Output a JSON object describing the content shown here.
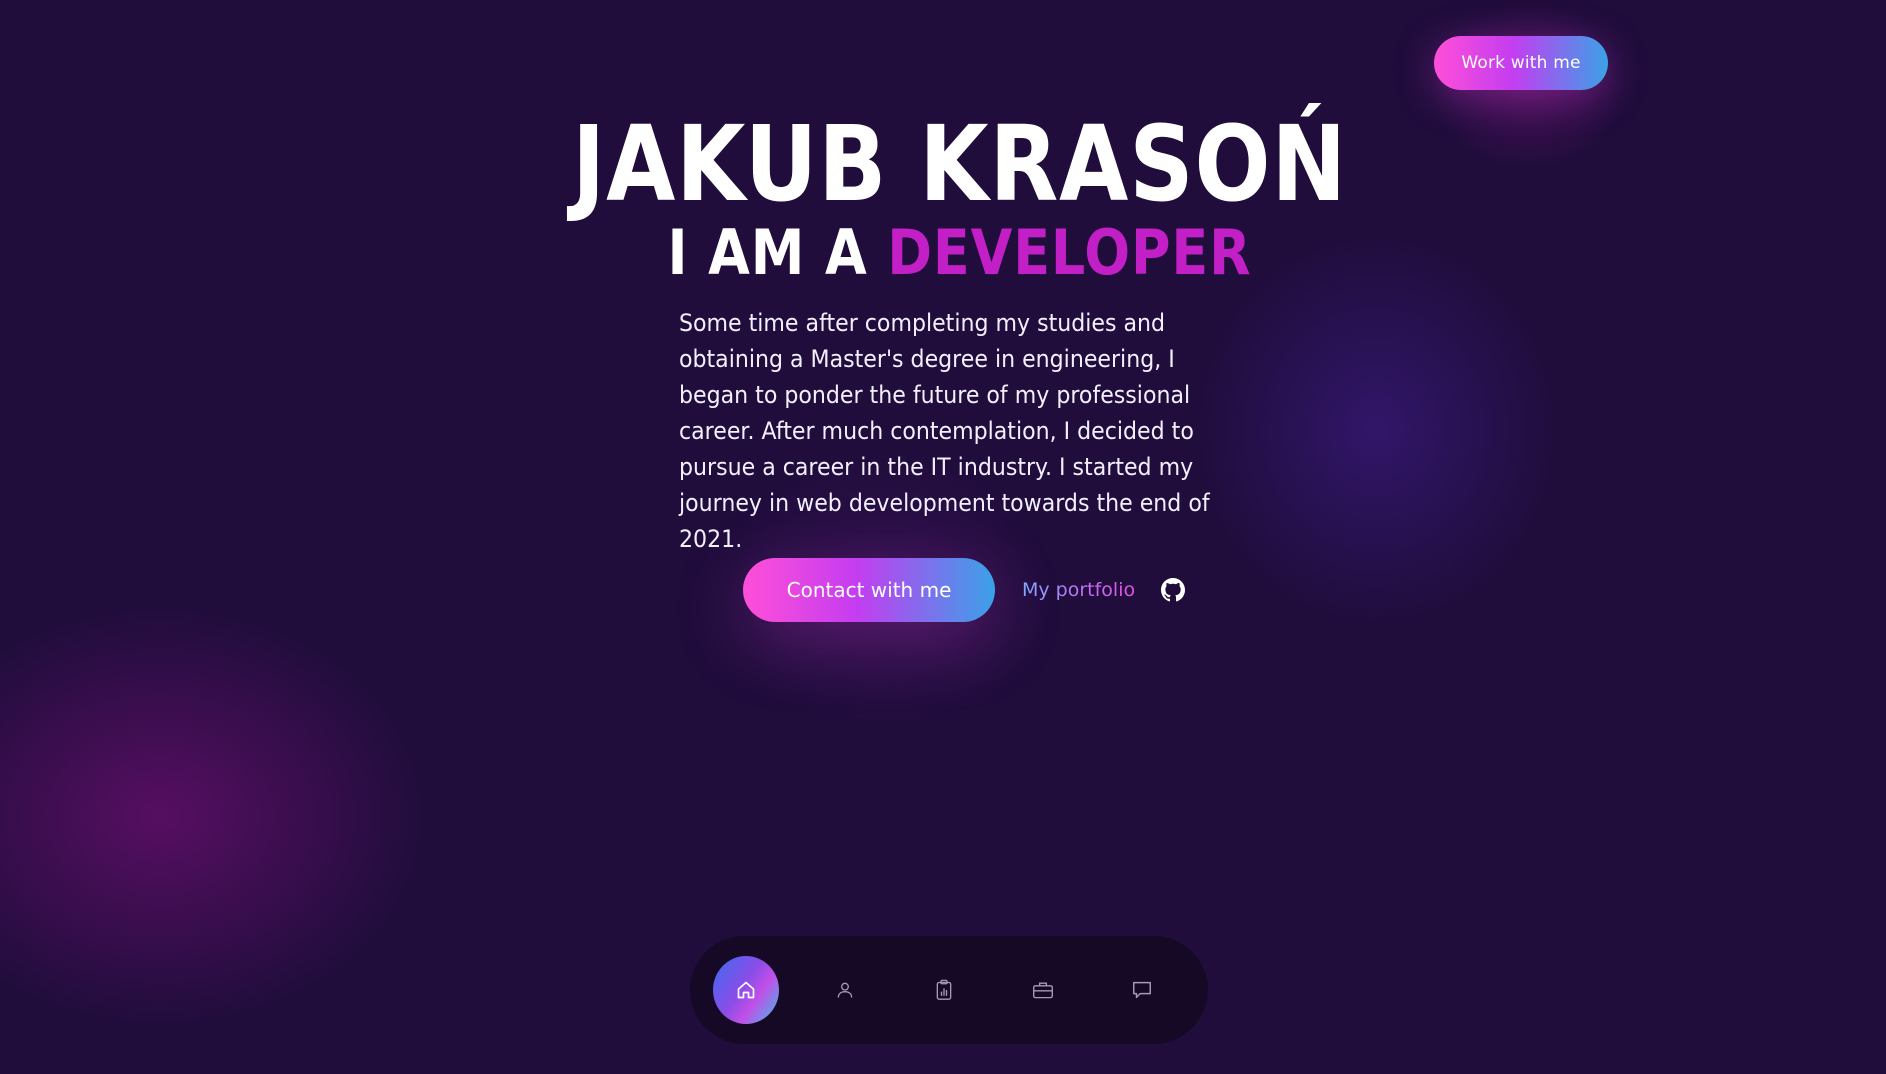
{
  "header": {
    "work_button_label": "Work with me"
  },
  "hero": {
    "name": "JAKUB KRASOŃ",
    "role_prefix": "I AM A ",
    "role_accent": "DEVELOPER",
    "intro": "Some time after completing my studies and obtaining a Master's degree in engineering, I began to ponder the future of my professional career. After much contemplation, I decided to pursue a career in the IT industry. I started my journey in web development towards the end of 2021."
  },
  "cta": {
    "contact_label": "Contact with me",
    "portfolio_label": "My portfolio",
    "github_icon": "github-icon"
  },
  "dock": {
    "items": [
      {
        "icon": "home-icon",
        "active": true
      },
      {
        "icon": "user-icon",
        "active": false
      },
      {
        "icon": "clipboard-chart-icon",
        "active": false
      },
      {
        "icon": "briefcase-icon",
        "active": false
      },
      {
        "icon": "chat-icon",
        "active": false
      }
    ]
  },
  "colors": {
    "background": "#200d3c",
    "accent_magenta": "#c21fc6",
    "gradient_start": "#ff4fd8",
    "gradient_end": "#3aa2e8"
  }
}
